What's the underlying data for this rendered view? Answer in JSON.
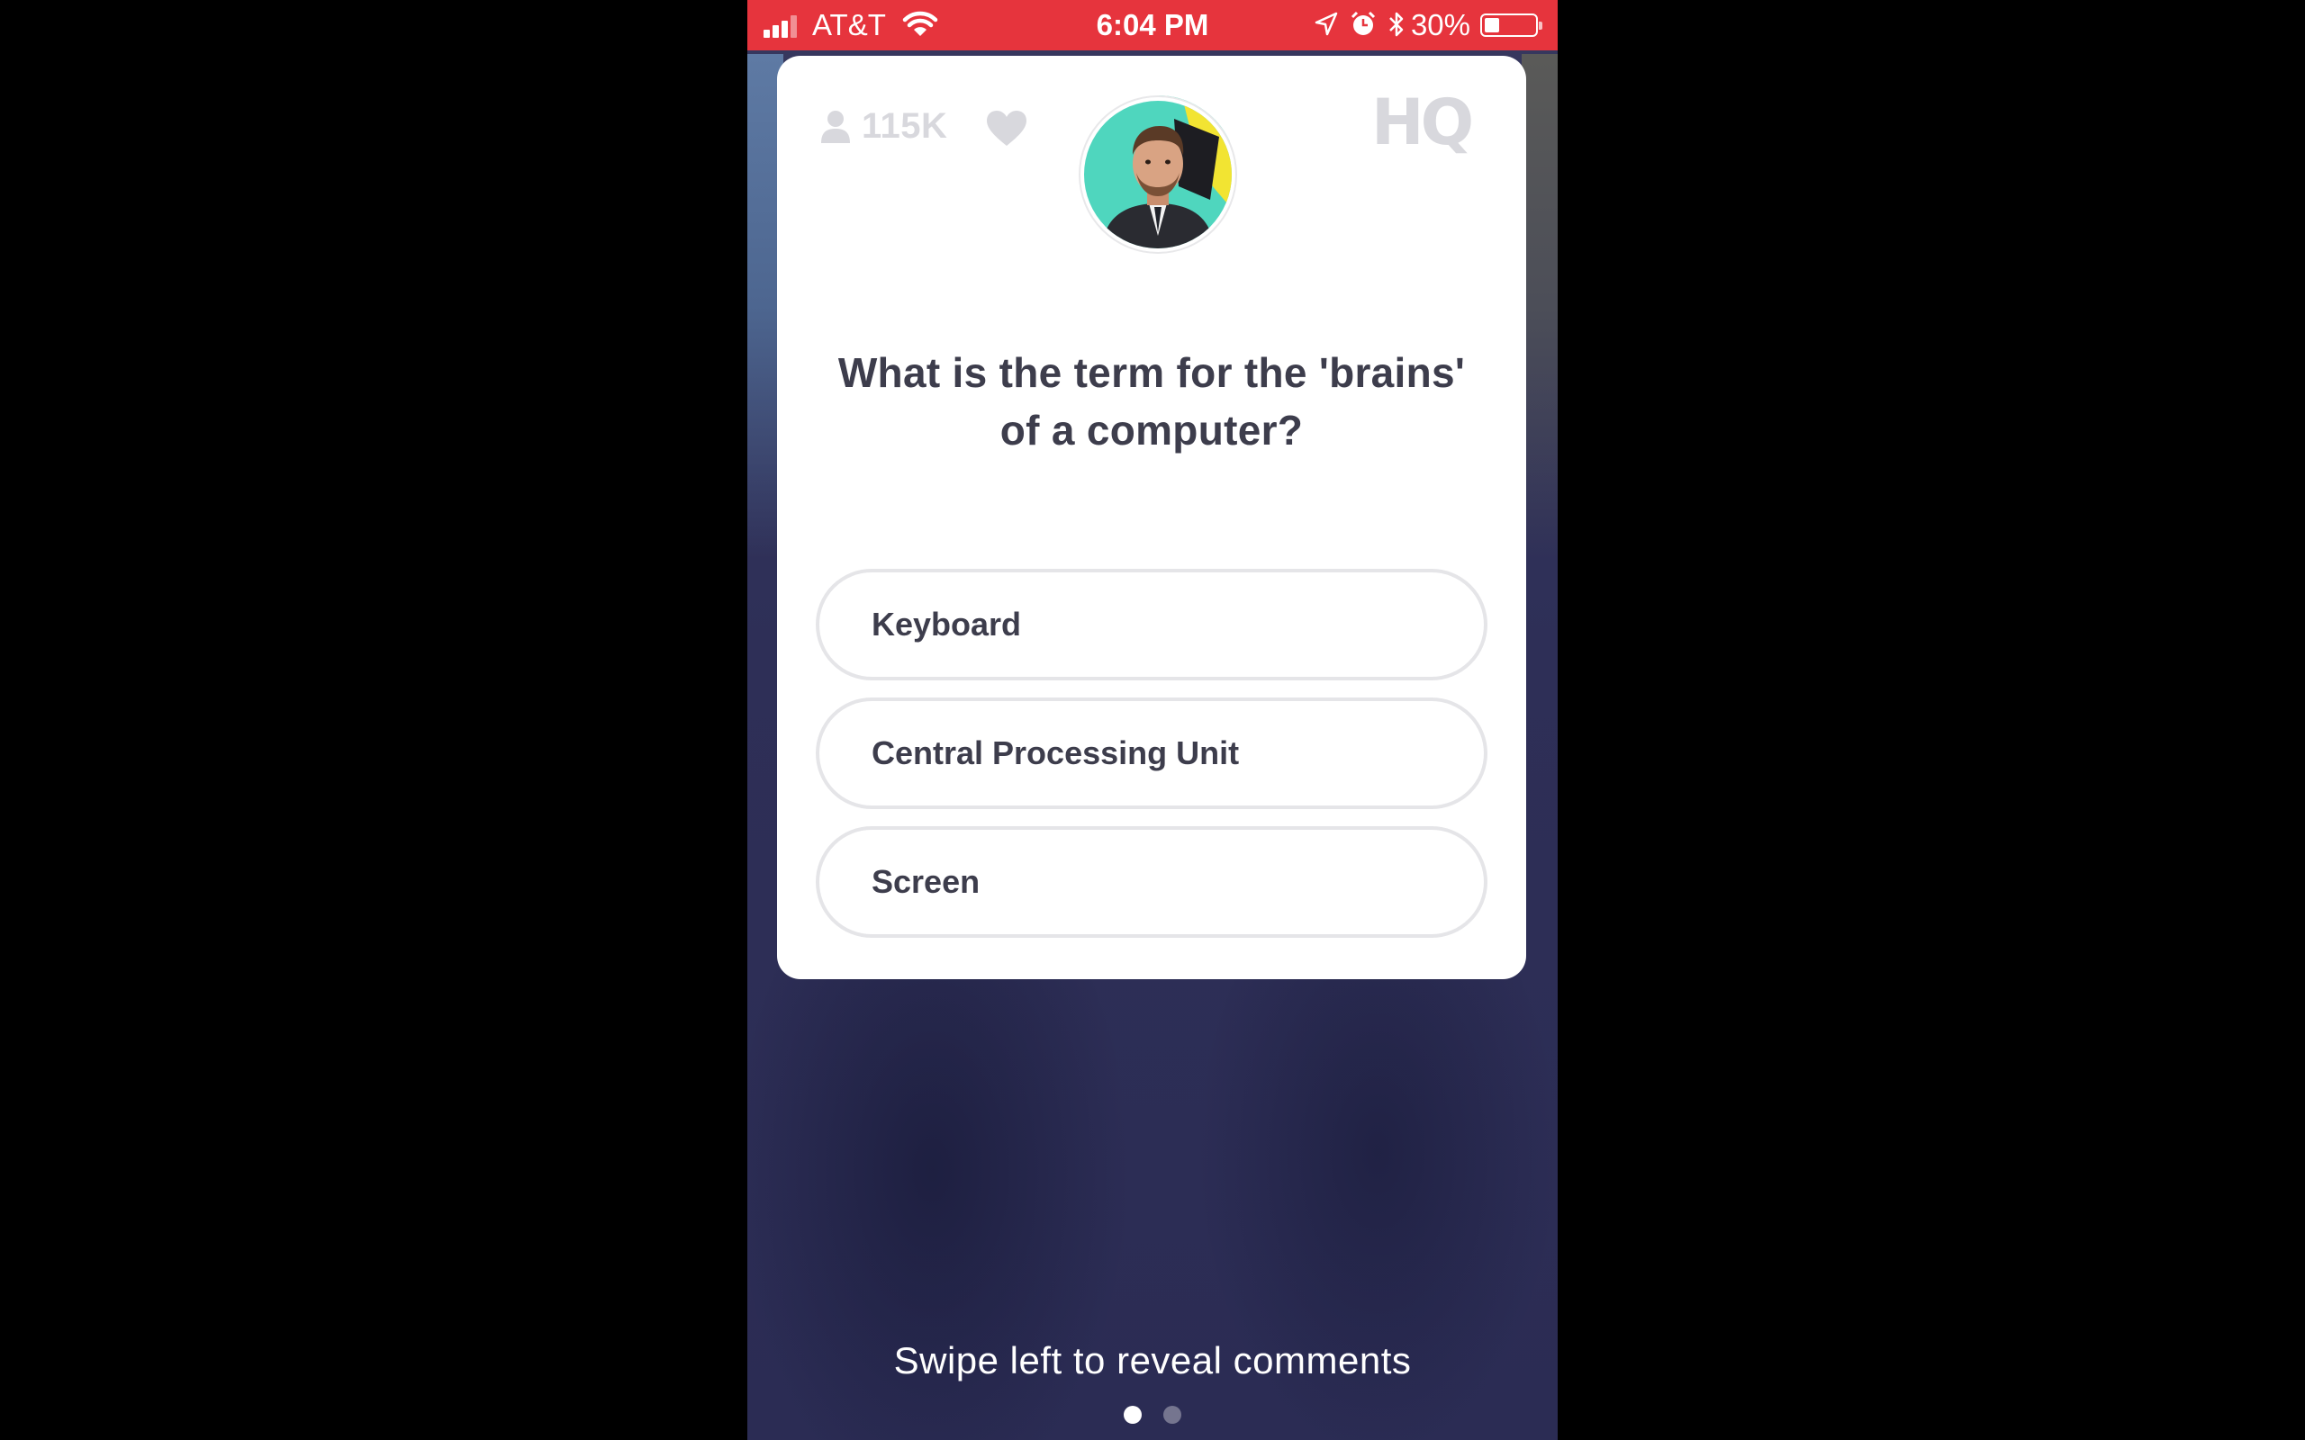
{
  "status_bar": {
    "carrier": "AT&T",
    "time": "6:04 PM",
    "battery_percent": "30%",
    "battery_level": 0.3,
    "color": "#e6343d",
    "icons": [
      "signal-icon",
      "wifi-icon",
      "location-icon",
      "alarm-icon",
      "bluetooth-icon",
      "battery-icon"
    ]
  },
  "game": {
    "viewer_count": "115K",
    "logo": "HQ",
    "question": "What is the term for the 'brains' of a computer?",
    "answers": [
      {
        "label": "Keyboard"
      },
      {
        "label": "Central Processing Unit"
      },
      {
        "label": "Screen"
      }
    ]
  },
  "footer": {
    "hint": "Swipe left to reveal comments",
    "pages": 2,
    "active_page": 1
  },
  "colors": {
    "accent_teal": "#5fe1c4",
    "background": "#2e2f57",
    "text_dark": "#3d3d4c"
  }
}
